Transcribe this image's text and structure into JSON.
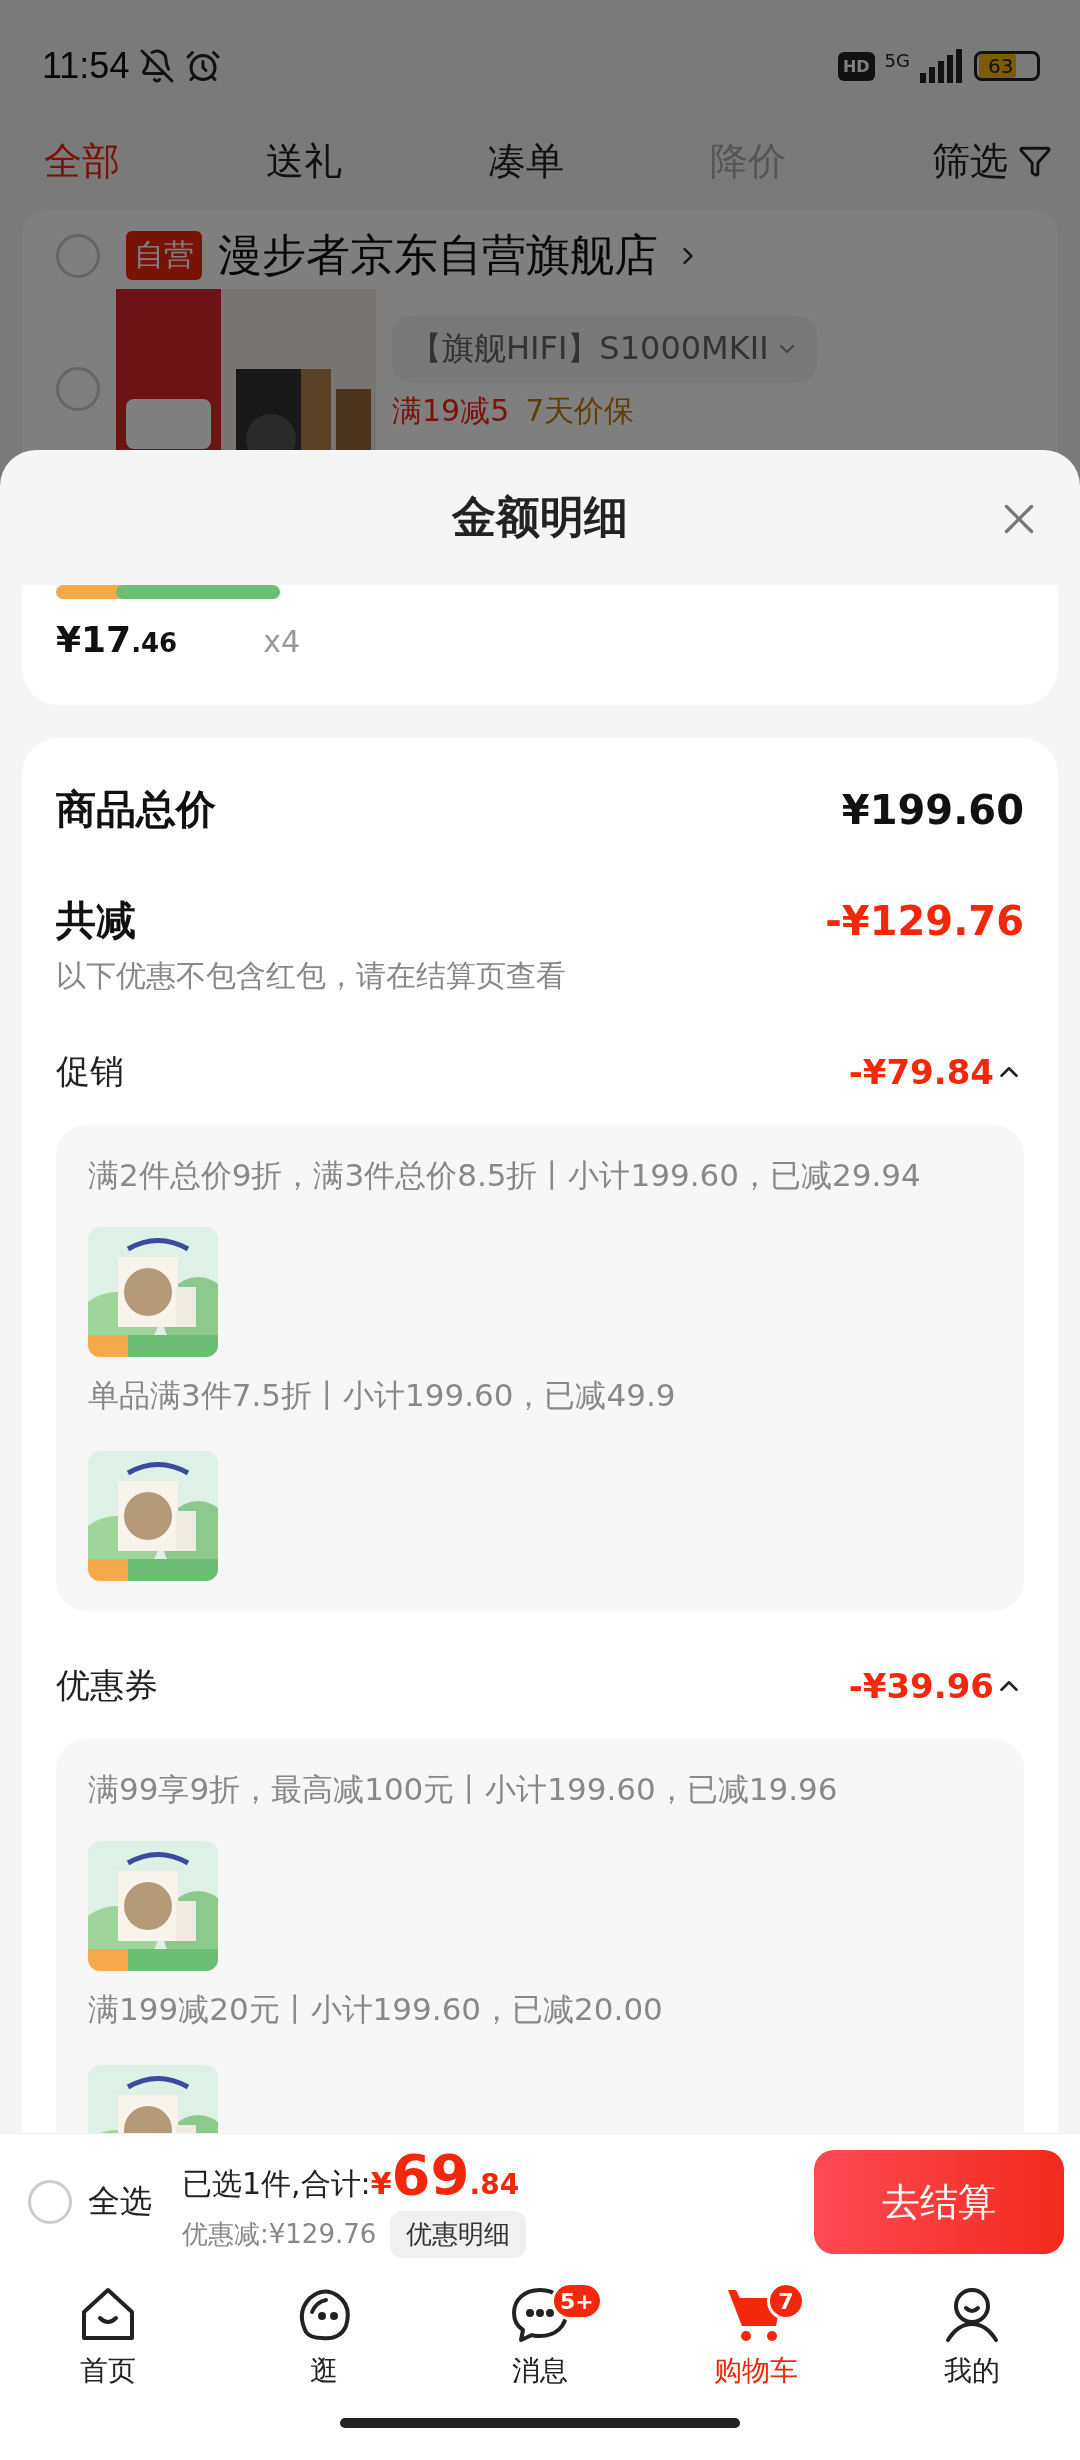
{
  "status_bar": {
    "time": "11:54",
    "hd": "HD",
    "network": "5G",
    "battery": "63"
  },
  "filter_tabs": [
    {
      "label": "全部",
      "selected": true,
      "disabled": false
    },
    {
      "label": "送礼",
      "selected": false,
      "disabled": false
    },
    {
      "label": "凑单",
      "selected": false,
      "disabled": false
    },
    {
      "label": "降价",
      "selected": false,
      "disabled": true
    }
  ],
  "filter_button": "筛选",
  "store": {
    "badge": "自营",
    "name": "漫步者京东自营旗舰店",
    "checked": false,
    "item_checked": false,
    "variant": "【旗舰HIFI】S1000MKII",
    "promos": [
      {
        "text": "满19减5",
        "kind": "discount"
      },
      {
        "text": "7天价保",
        "kind": "guarantee"
      }
    ]
  },
  "sheet": {
    "title": "金额明细",
    "item": {
      "price": "¥17",
      "cents": ".46",
      "qty": "x4"
    },
    "summary": {
      "total_label": "商品总价",
      "total": "¥199.60",
      "reduce_label": "共减",
      "reduce": "-¥129.76",
      "note": "以下优惠不包含红包，请在结算页查看"
    },
    "groups": [
      {
        "title": "促销",
        "amount": "-¥79.84",
        "expanded": true,
        "rules": [
          "满2件总价9折，满3件总价8.5折丨小计199.60，已减29.94",
          "单品满3件7.5折丨小计199.60，已减49.9"
        ]
      },
      {
        "title": "优惠券",
        "amount": "-¥39.96",
        "expanded": true,
        "rules": [
          "满99享9折，最高减100元丨小计199.60，已减19.96",
          "满199减20元丨小计199.60，已减20.00"
        ]
      }
    ]
  },
  "checkout_bar": {
    "select_all": {
      "label": "全选",
      "checked": false
    },
    "selected_label": "已选1件,合计:",
    "currency": "¥",
    "amount": "69",
    "cents": ".84",
    "discount": "优惠减:¥129.76",
    "detail_button": "优惠明细",
    "checkout_button": "去结算"
  },
  "nav": [
    {
      "label": "首页",
      "kind": "home",
      "selected": false
    },
    {
      "label": "逛",
      "kind": "explore",
      "selected": false
    },
    {
      "label": "消息",
      "kind": "message",
      "selected": false,
      "badge": "5+"
    },
    {
      "label": "购物车",
      "kind": "cart",
      "selected": true,
      "badge": "7"
    },
    {
      "label": "我的",
      "kind": "profile",
      "selected": false
    }
  ]
}
